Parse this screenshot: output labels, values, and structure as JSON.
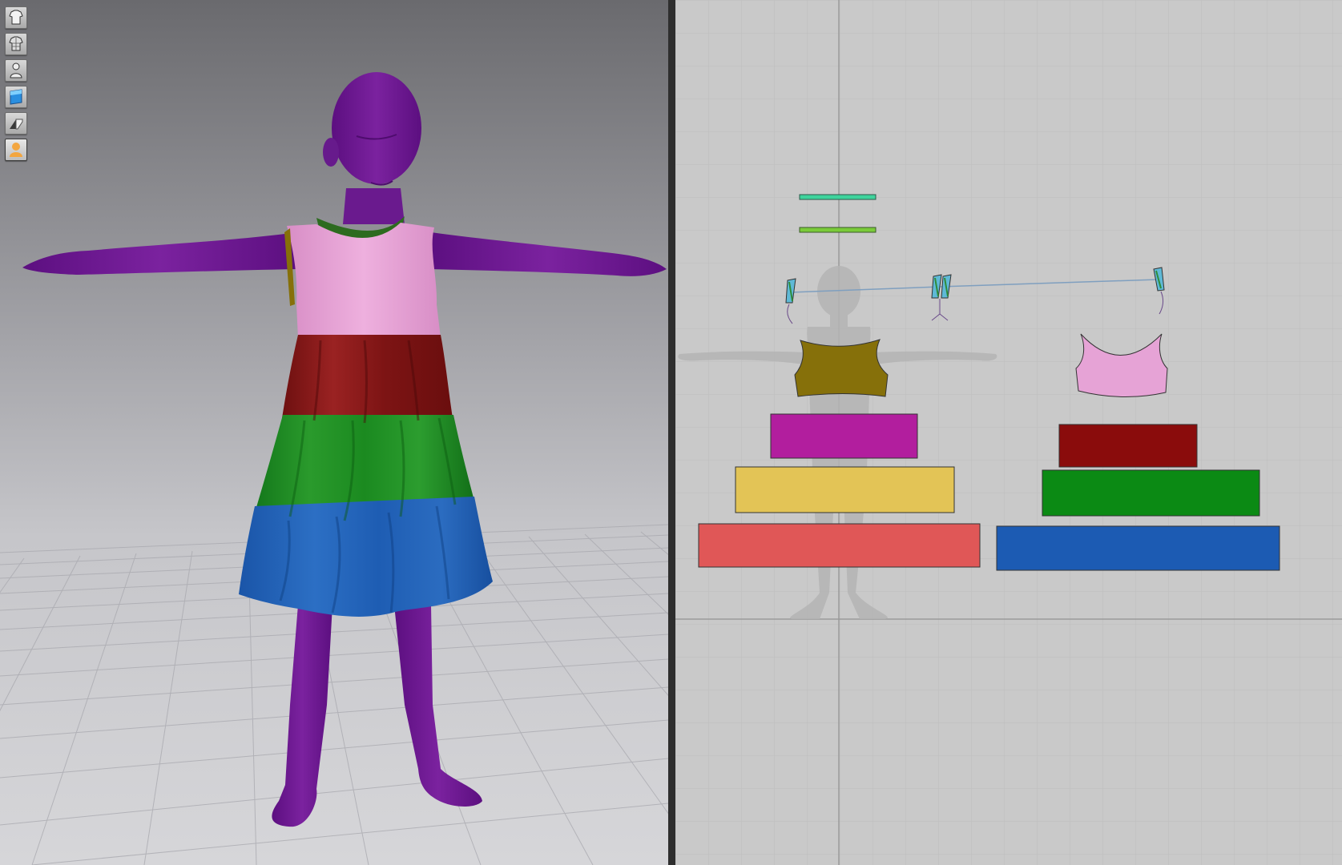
{
  "toolbar": {
    "items": [
      {
        "name": "garment-shaded-tool",
        "icon": "garment-shaded-icon"
      },
      {
        "name": "garment-wireframe-tool",
        "icon": "garment-wireframe-icon"
      },
      {
        "name": "avatar-tool",
        "icon": "avatar-icon"
      },
      {
        "name": "texture-tool",
        "icon": "texture-icon"
      },
      {
        "name": "eraser-tool",
        "icon": "eraser-icon"
      },
      {
        "name": "avatar-skin-tool",
        "icon": "avatar-skin-icon"
      }
    ]
  },
  "colors": {
    "avatar": "#6e1a92",
    "bodice_front": "#e6a3d6",
    "bodice_back": "#86700a",
    "tier1_back": "#b21e9e",
    "tier2_back": "#e3c456",
    "tier3_back": "#e05757",
    "tier1_front": "#8a0c0c",
    "tier2_front": "#0b8a14",
    "tier3_front": "#1c5bb3",
    "binding_1": "#3fd39c",
    "binding_2": "#7acb3a",
    "grid_2d": "#c9c9c9",
    "floor_3d": "#d3d3d6"
  }
}
